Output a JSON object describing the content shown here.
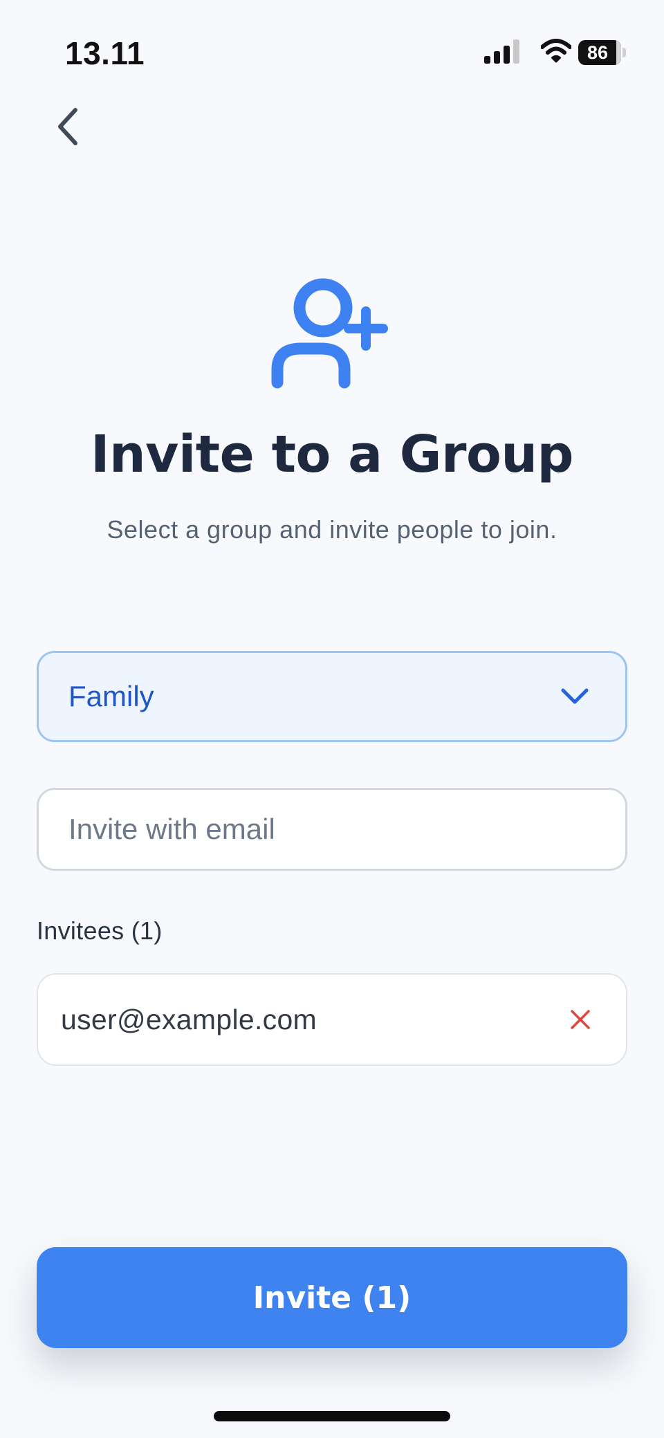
{
  "status_bar": {
    "time": "13.11",
    "battery_level": "86",
    "icons": [
      "signal-icon",
      "wifi-icon",
      "battery-icon"
    ]
  },
  "navigation": {
    "back_icon": "chevron-left-icon"
  },
  "header": {
    "icon": "user-plus-icon",
    "title": "Invite to a Group",
    "subtitle": "Select a group and invite people to join."
  },
  "group_select": {
    "selected": "Family",
    "icon": "chevron-down-icon"
  },
  "email_input": {
    "value": "",
    "placeholder": "Invite with email"
  },
  "invitees": {
    "label": "Invitees (1)",
    "items": [
      {
        "email": "user@example.com",
        "remove_icon": "close-icon"
      }
    ]
  },
  "invite_button": {
    "label": "Invite (1)"
  },
  "colors": {
    "accent": "#3f83f1",
    "title": "#1e2940",
    "select_background": "#eef5ff",
    "select_text": "#1f55c7",
    "remove": "#e0463c",
    "background": "#f7f9fc"
  }
}
